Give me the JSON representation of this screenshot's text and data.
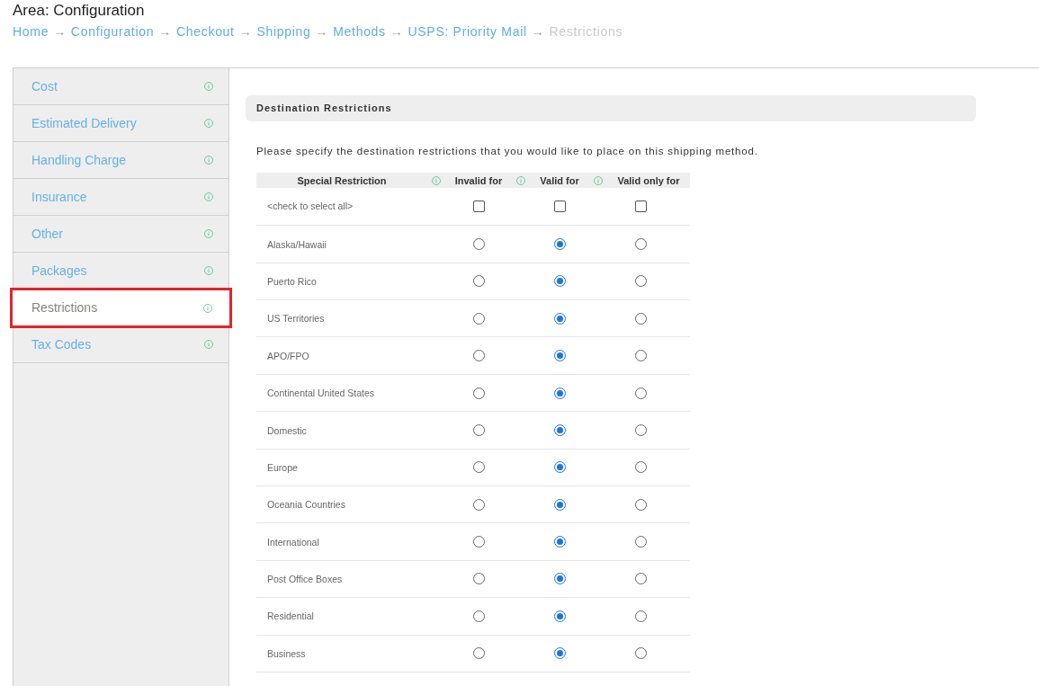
{
  "page": {
    "title": "Area: Configuration"
  },
  "breadcrumb": {
    "items": [
      {
        "label": "Home",
        "arrow": "→",
        "current": false
      },
      {
        "label": "Configuration",
        "arrow": "→",
        "current": false
      },
      {
        "label": "Checkout",
        "arrow": "→",
        "current": false
      },
      {
        "label": "Shipping",
        "arrow": "→",
        "current": false
      },
      {
        "label": "Methods",
        "arrow": "→",
        "current": false
      },
      {
        "label": "USPS: Priority Mail",
        "arrow": "→",
        "current": false
      },
      {
        "label": "Restrictions",
        "current": true
      }
    ]
  },
  "sidebar": {
    "items": [
      {
        "label": "Cost",
        "selected": false
      },
      {
        "label": "Estimated Delivery",
        "selected": false
      },
      {
        "label": "Handling Charge",
        "selected": false
      },
      {
        "label": "Insurance",
        "selected": false
      },
      {
        "label": "Other",
        "selected": false
      },
      {
        "label": "Packages",
        "selected": false
      },
      {
        "label": "Restrictions",
        "selected": true
      },
      {
        "label": "Tax Codes",
        "selected": false
      }
    ]
  },
  "panel": {
    "title": "Destination Restrictions",
    "description": "Please specify the destination restrictions that you would like to place on this shipping method.",
    "table": {
      "columns": [
        "Special Restriction",
        "Invalid for",
        "Valid for",
        "Valid only for"
      ],
      "select_all": {
        "label": "<check to select all>",
        "checks": [
          {
            "checked": false
          },
          {
            "checked": false
          },
          {
            "checked": false
          }
        ]
      },
      "rows": [
        {
          "label": "Alaska/Hawaii",
          "options": [
            {
              "selected": false
            },
            {
              "selected": true
            },
            {
              "selected": false
            }
          ]
        },
        {
          "label": "Puerto Rico",
          "options": [
            {
              "selected": false
            },
            {
              "selected": true
            },
            {
              "selected": false
            }
          ]
        },
        {
          "label": "US Territories",
          "options": [
            {
              "selected": false
            },
            {
              "selected": true
            },
            {
              "selected": false
            }
          ]
        },
        {
          "label": "APO/FPO",
          "options": [
            {
              "selected": false
            },
            {
              "selected": true
            },
            {
              "selected": false
            }
          ]
        },
        {
          "label": "Continental United States",
          "options": [
            {
              "selected": false
            },
            {
              "selected": true
            },
            {
              "selected": false
            }
          ]
        },
        {
          "label": "Domestic",
          "options": [
            {
              "selected": false
            },
            {
              "selected": true
            },
            {
              "selected": false
            }
          ]
        },
        {
          "label": "Europe",
          "options": [
            {
              "selected": false
            },
            {
              "selected": true
            },
            {
              "selected": false
            }
          ]
        },
        {
          "label": "Oceania Countries",
          "options": [
            {
              "selected": false
            },
            {
              "selected": true
            },
            {
              "selected": false
            }
          ]
        },
        {
          "label": "International",
          "options": [
            {
              "selected": false
            },
            {
              "selected": true
            },
            {
              "selected": false
            }
          ]
        },
        {
          "label": "Post Office Boxes",
          "options": [
            {
              "selected": false
            },
            {
              "selected": true
            },
            {
              "selected": false
            }
          ]
        },
        {
          "label": "Residential",
          "options": [
            {
              "selected": false
            },
            {
              "selected": true
            },
            {
              "selected": false
            }
          ]
        },
        {
          "label": "Business",
          "options": [
            {
              "selected": false
            },
            {
              "selected": true
            },
            {
              "selected": false
            }
          ]
        }
      ]
    }
  }
}
